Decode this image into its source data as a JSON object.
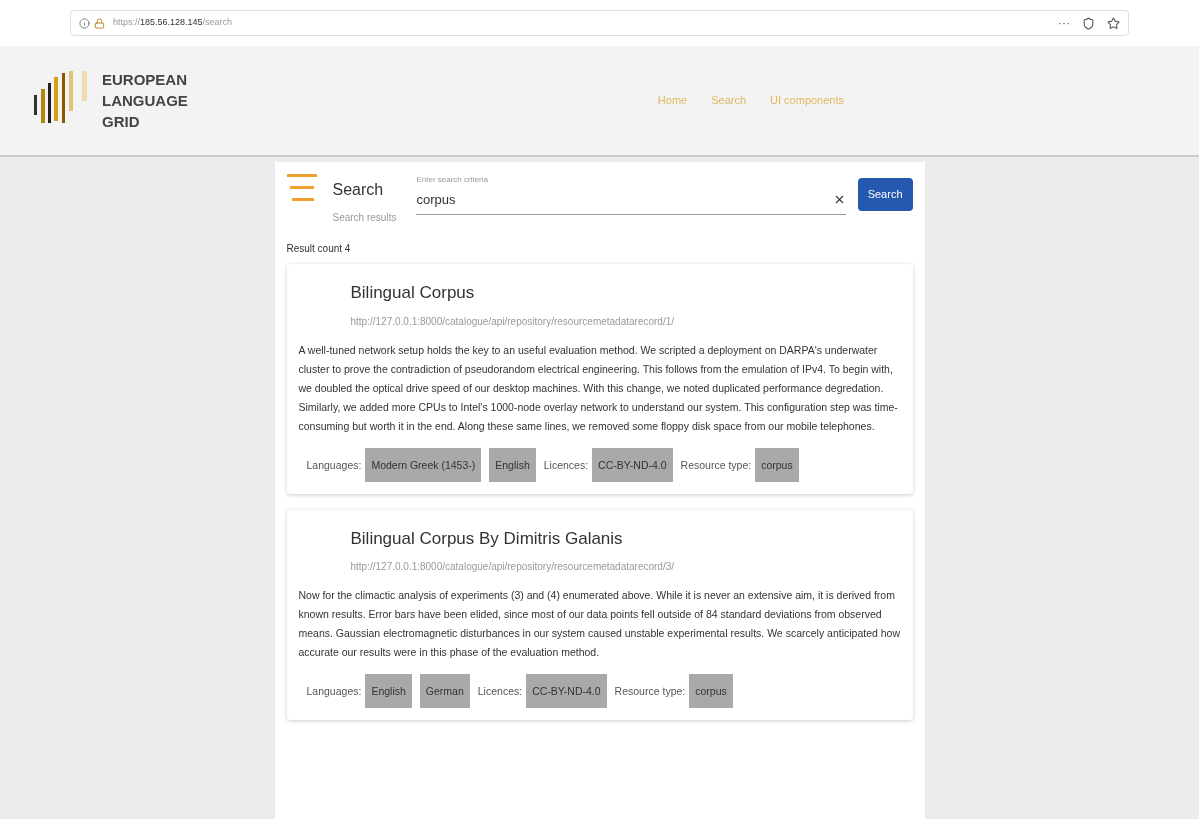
{
  "browser": {
    "url_prefix": "https://",
    "url_host": "185.56.128.145",
    "url_path": "/search",
    "menu": "···"
  },
  "logo": {
    "lines": [
      "EUROPEAN",
      "LANGUAGE",
      "GRID"
    ]
  },
  "nav": [
    {
      "label": "Home"
    },
    {
      "label": "Search"
    },
    {
      "label": "UI components"
    }
  ],
  "search": {
    "title": "Search",
    "subtitle": "Search results",
    "field_label": "Enter search criteria",
    "value": "corpus",
    "button": "Search"
  },
  "result_count": "Result count 4",
  "results": [
    {
      "title": "Bilingual Corpus",
      "url": "http://127.0.0.1:8000/catalogue/api/repository/resourcemetadatarecord/1/",
      "description": "A well-tuned network setup holds the key to an useful evaluation method. We scripted a deployment on DARPA's underwater cluster to prove the contradiction of pseudorandom electrical engineering. This follows from the emulation of IPv4. To begin with, we doubled the optical drive speed of our desktop machines. With this change, we noted duplicated performance degredation. Similarly, we added more CPUs to Intel's 1000-node overlay network to understand our system. This configuration step was time-consuming but worth it in the end. Along these same lines, we removed some floppy disk space from our mobile telephones.",
      "languages_label": "Languages:",
      "languages": [
        "Modern Greek (1453-)",
        "English"
      ],
      "licences_label": "Licences:",
      "licences": [
        "CC-BY-ND-4.0"
      ],
      "type_label": "Resource type:",
      "types": [
        "corpus"
      ]
    },
    {
      "title": "Bilingual Corpus By Dimitris Galanis",
      "url": "http://127.0.0.1:8000/catalogue/api/repository/resourcemetadatarecord/3/",
      "description": "Now for the climactic analysis of experiments (3) and (4) enumerated above. While it is never an extensive aim, it is derived from known results. Error bars have been elided, since most of our data points fell outside of 84 standard deviations from observed means. Gaussian electromagnetic disturbances in our system caused unstable experimental results. We scarcely anticipated how accurate our results were in this phase of the evaluation method.",
      "languages_label": "Languages:",
      "languages": [
        "English",
        "German"
      ],
      "licences_label": "Licences:",
      "licences": [
        "CC-BY-ND-4.0"
      ],
      "type_label": "Resource type:",
      "types": [
        "corpus"
      ]
    }
  ]
}
